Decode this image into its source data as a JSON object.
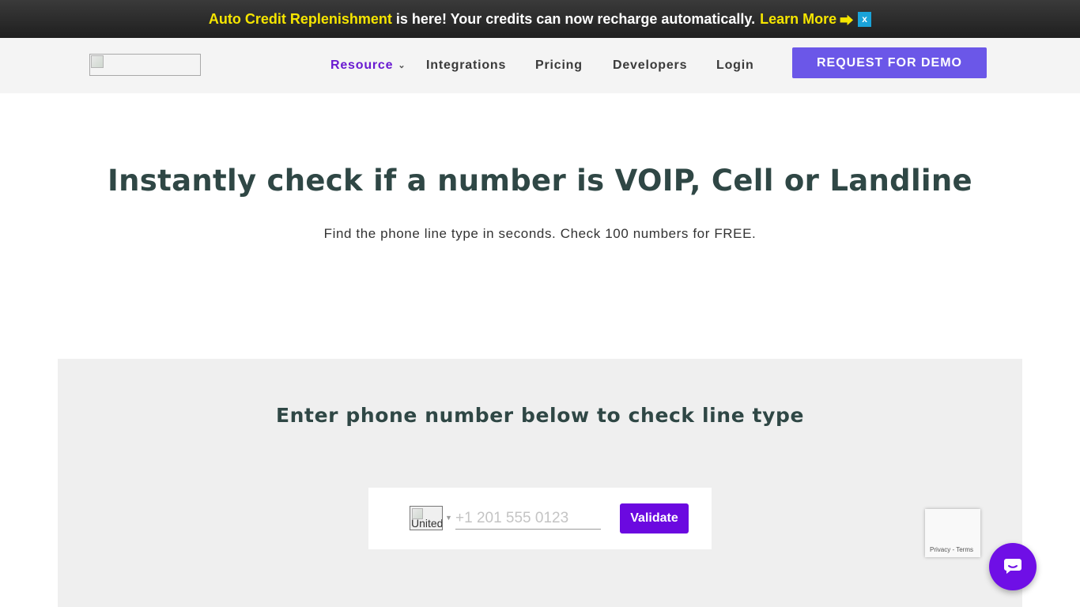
{
  "announcement": {
    "highlight": "Auto Credit Replenishment",
    "text": "is here! Your credits can now recharge automatically.",
    "link": "Learn More",
    "arrow": "⮕",
    "close": "x"
  },
  "header": {
    "nav": {
      "resource": "Resource",
      "integrations": "Integrations",
      "pricing": "Pricing",
      "developers": "Developers",
      "login": "Login"
    },
    "cta": "REQUEST FOR DEMO"
  },
  "hero": {
    "title": "Instantly check if a number is VOIP, Cell or Landline",
    "subtitle": "Find the phone line type in seconds. Check 100 numbers for FREE."
  },
  "checker": {
    "title": "Enter phone number below to check line type",
    "flag_alt": "United",
    "phone_placeholder": "+1 201 555 0123",
    "validate_label": "Validate"
  },
  "recaptcha": {
    "privacy": "Privacy",
    "separator": "-",
    "terms": "Terms"
  },
  "colors": {
    "accent": "#6b09e0",
    "cta": "#6b57e8",
    "highlight": "#f5e500",
    "heading": "#2f4745"
  }
}
